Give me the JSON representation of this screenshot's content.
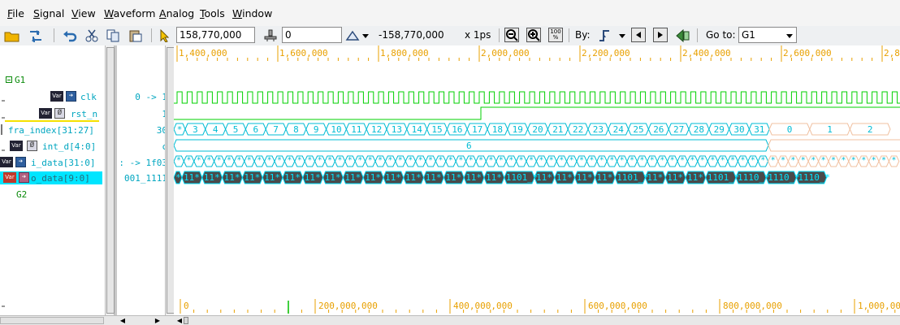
{
  "menu": [
    {
      "label": "File",
      "u": "F",
      "rest": "ile"
    },
    {
      "label": "Signal",
      "u": "S",
      "rest": "ignal"
    },
    {
      "label": "View",
      "u": "V",
      "rest": "iew"
    },
    {
      "label": "Waveform",
      "u": "W",
      "rest": "aveform"
    },
    {
      "label": "Analog",
      "u": "A",
      "rest": "nalog"
    },
    {
      "label": "Tools",
      "u": "T",
      "rest": "ools"
    },
    {
      "label": "Window",
      "u": "W",
      "rest": "indow"
    }
  ],
  "toolbar": {
    "cursor_time": "158,770,000",
    "marker_value": "0",
    "delta_value": "-158,770,000",
    "unit": "x 1ps",
    "zoom_pct": "100 %",
    "by_label": "By:",
    "goto_label": "Go to:",
    "goto_value": "G1"
  },
  "signals": {
    "group1": "G1",
    "group2": "G2",
    "rows": [
      {
        "name": "clk",
        "value": "0 -> 1"
      },
      {
        "name": "rst_n",
        "value": "1"
      },
      {
        "name": "fra_index[31:27]",
        "value": "30"
      },
      {
        "name": "int_d[4:0]",
        "value": "c"
      },
      {
        "name": "i_data[31:0]",
        "value": ": -> 1f03"
      },
      {
        "name": "o_data[9:0]",
        "value": "001_1111"
      }
    ],
    "badge_text": "Var"
  },
  "ruler": {
    "top_labels": [
      "1,400,000",
      "1,600,000",
      "1,800,000",
      "2,000,000",
      "2,200,000",
      "2,400,000",
      "2,600,000",
      "2,8"
    ],
    "bottom_labels": [
      "0",
      "200,000,000",
      "400,000,000",
      "600,000,000",
      "800,000,000",
      "1,000,00"
    ]
  },
  "waves": {
    "fra_index_values": [
      "*",
      "3",
      "4",
      "5",
      "6",
      "7",
      "8",
      "9",
      "10",
      "11",
      "12",
      "13",
      "14",
      "15",
      "16",
      "17",
      "18",
      "19",
      "20",
      "21",
      "22",
      "23",
      "24",
      "25",
      "26",
      "27",
      "28",
      "29",
      "30",
      "31",
      "0",
      "1",
      "2"
    ],
    "int_d_value": "6",
    "i_data_cell": "*",
    "o_data_cells": [
      "*",
      "11*",
      "11*",
      "11*",
      "11*",
      "11*",
      "11*",
      "11*",
      "11*",
      "11*",
      "11*",
      "11*",
      "11*",
      "11*",
      "11*",
      "11*",
      "11*",
      "1101_*",
      "11*",
      "11*",
      "11*",
      "11*",
      "1101_*",
      "11*",
      "11*",
      "11*",
      "1101_*",
      "1110_*",
      "1110_*",
      "1110_*"
    ]
  },
  "colors": {
    "wave": "#00d000",
    "bus": "#00bcd4",
    "bus_dark": "#4a4a4a",
    "ruler": "#e8a000",
    "selected": "#00e5ff"
  }
}
